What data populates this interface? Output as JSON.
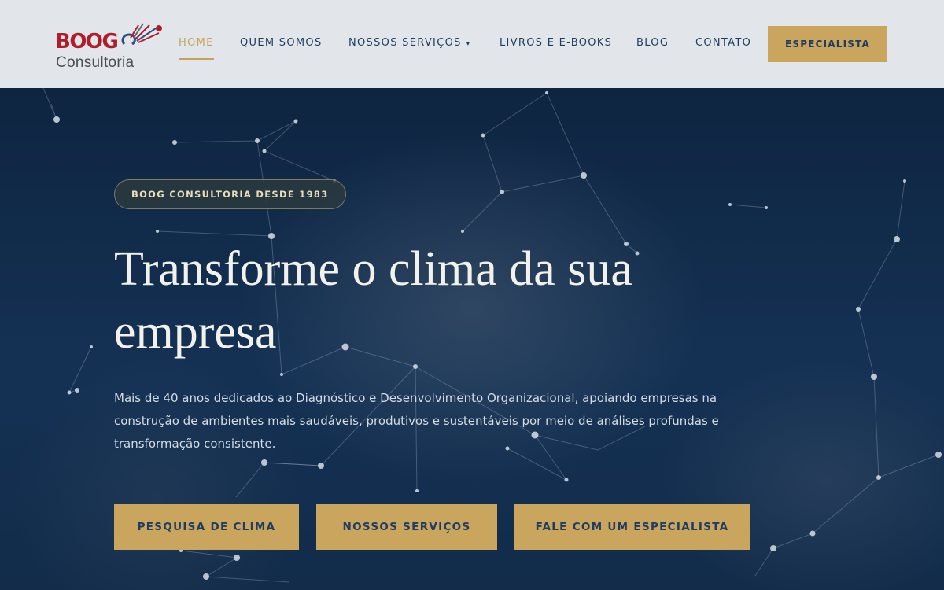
{
  "header": {
    "logo_text": "BOOG",
    "logo_subtext": "Consultoria",
    "nav": [
      {
        "label": "HOME",
        "active": true
      },
      {
        "label": "QUEM SOMOS"
      },
      {
        "label": "NOSSOS SERVIÇOS",
        "caret": "▾"
      },
      {
        "label": "LIVROS E E-BOOKS"
      },
      {
        "label": "BLOG"
      },
      {
        "label": "CONTATO"
      }
    ],
    "cta_label": "ESPECIALISTA"
  },
  "hero": {
    "badge": "BOOG CONSULTORIA DESDE 1983",
    "title": "Transforme o clima da sua empresa",
    "description": "Mais de 40 anos dedicados ao Diagnóstico e Desenvolvimento Organizacional, apoiando empresas na construção de ambientes mais saudáveis, produtivos e sustentáveis por meio de análises profundas e transformação consistente.",
    "buttons": [
      {
        "label": "PESQUISA DE CLIMA"
      },
      {
        "label": "NOSSOS SERVIÇOS"
      },
      {
        "label": "FALE COM UM ESPECIALISTA"
      }
    ]
  },
  "colors": {
    "accent_gold": "#c9a55e",
    "navy": "#1f3d63",
    "hero_bg": "#102a45",
    "header_bg": "#e2e6ea",
    "logo_red": "#b01d2a"
  },
  "icons": {
    "logo": "boog-logo-mark",
    "dropdown": "caret-down-icon"
  }
}
